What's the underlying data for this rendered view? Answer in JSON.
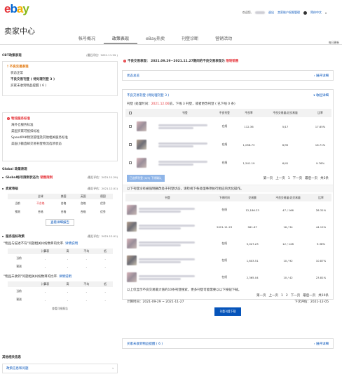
{
  "header": {
    "logo": [
      "e",
      "b",
      "a",
      "y"
    ],
    "welcome": "欢迎您,",
    "sign_out": "退出",
    "my_account": "卖家账户权限管理",
    "language": "简体中文",
    "title": "卖家中心"
  },
  "tabs": [
    {
      "label": "帐号概况"
    },
    {
      "label": "政策表现",
      "active": true
    },
    {
      "label": "eBay热卖"
    },
    {
      "label": "刊登诊断"
    },
    {
      "label": "营销活动"
    }
  ],
  "tab_note": "每日更新",
  "left": {
    "cbt": {
      "title": "CBT政策表现",
      "eval_date": "(最后评估：2021.11.29 )",
      "alert": "不良交易表现",
      "items": [
        "状态正常",
        "不良交易刊登 ( 待处理刊登 3 )",
        "买家未收到物品提醒 ( 6 )"
      ]
    },
    "logistics": {
      "title": "物流服务标准",
      "items": [
        "海外仓服务标准",
        "美国买家可抵扣标准",
        "SpeedPAK物流管理及其他相关服务标准",
        "美国小额直邮交易刊登物流选项状态"
      ]
    },
    "global": {
      "title": "Global 政策表现",
      "account_status_prefix": "Global帐号限制状态为",
      "account_status": "销售限制",
      "account_date": "(最后评估：2021.11.29)",
      "seller_level": {
        "title": "卖家等级",
        "date": "(最后评估：2021.12.01)",
        "headers": [
          "",
          "全球",
          "美国",
          "英国",
          "德国"
        ],
        "rows": [
          [
            "当前",
            "不合格",
            "合格",
            "合格",
            "优秀"
          ],
          [
            "预测",
            "合格",
            "合格",
            "合格",
            "优秀"
          ]
        ],
        "link": "查看详细报告"
      },
      "service": {
        "title": "服务指标政策",
        "date": "(最后评估：2021.12.01)",
        "desc1": "\"物品与描述不符\"问题相关纠纷数目的比率.",
        "desc1_link": "详情说明",
        "table_headers": [
          "",
          "计算表",
          "高",
          "不均",
          "低"
        ],
        "rows1": [
          [
            "当前",
            "-",
            "-",
            "-",
            "-"
          ],
          [
            "预测",
            "-",
            "-",
            "-",
            "-"
          ]
        ],
        "desc2": "\"物品未收到\"问题相关纠纷数目的比率.",
        "desc2_link": "详情说明",
        "rows2": [
          [
            "当前",
            "-",
            "-",
            "-",
            "-"
          ],
          [
            "预测",
            "-",
            "-",
            "-",
            "-"
          ]
        ],
        "link": "查看详细报告"
      }
    },
    "other": {
      "title": "其他相关信息",
      "item": "政策信息和问题"
    }
  },
  "right": {
    "notice_prefix": "不良交易表现：",
    "notice_period": "2021.09.29~2021.11.27期间的不良交易表现为",
    "notice_status": "限制销售",
    "status_box": {
      "label": "状态总览",
      "link": "展开详细"
    },
    "pending": {
      "title": "不良交易刊登 (待处理刊登 3 )",
      "link": "收起详细",
      "sub_prefix": "刊登 (处理时间：",
      "sub_date": "2021.12.06",
      "sub_suffix": "前，下线 3 刊登，或者更改刊登 ( 已下线 0 条)",
      "headers": [
        "",
        "",
        "刊登",
        "不良刊登",
        "不良率",
        "近期不良率",
        "不良交易量/总交易量",
        "比率"
      ],
      "rows": [
        {
          "status": "在线",
          "bad": "112.36",
          "ratio": "5/17",
          "pct": "17.65%"
        },
        {
          "status": "在线",
          "bad": "1,058.73",
          "ratio": "6/35",
          "pct": "16.71%"
        },
        {
          "status": "在线",
          "bad": "1,541.19",
          "ratio": "6/41",
          "pct": "9.76%"
        }
      ],
      "bulk_btn": "已选择刊登 (0/3) 下线确认",
      "pager": [
        "第一页",
        "上一页",
        "1",
        "下一页",
        "最后一页",
        "共3条"
      ]
    },
    "list": {
      "intro": "以下刊登没有被强制删改处于刊登状态，请检视下各处理事项执行相应的优化操作。",
      "headers": [
        "刊登",
        "下线时间",
        "交易额",
        "不良交易量/总交易量",
        "比率"
      ],
      "rows": [
        {
          "time": "在线",
          "amt": "12,186.23",
          "ratio": "47 / 166",
          "pct": "28.31%"
        },
        {
          "time": "2021-11-23",
          "amt": "961.67",
          "ratio": "16 / 34",
          "pct": "44.12%"
        },
        {
          "time": "在线",
          "amt": "5,027.23",
          "ratio": "12 / 128",
          "pct": "9.38%"
        },
        {
          "time": "在线",
          "amt": "1,603.51",
          "ratio": "10 / 92",
          "pct": "10.87%"
        },
        {
          "time": "在线",
          "amt": "2,365.04",
          "ratio": "10 / 42",
          "pct": "23.81%"
        }
      ],
      "foot_note": "以上仅显示不良交易最大值的10条刊登搜索，更多刊登可能需要以以下按钮下载。",
      "pager": [
        "第一页",
        "上一页",
        "1",
        "2",
        "下一页",
        "最后一页",
        "共10条"
      ],
      "period_prefix": "计算时间：",
      "period": "2021-09-29 ~ 2021-11-27",
      "next_eval": "下次评估：2021-12-05",
      "download_btn": "刊登刊登下载"
    },
    "buyer_box": {
      "label": "买家未收到物品提醒 ( 6 )",
      "link": "展开详细"
    }
  },
  "colors": {
    "accent": "#0654ba",
    "alert": "#e53238",
    "warning": "#e07000"
  }
}
